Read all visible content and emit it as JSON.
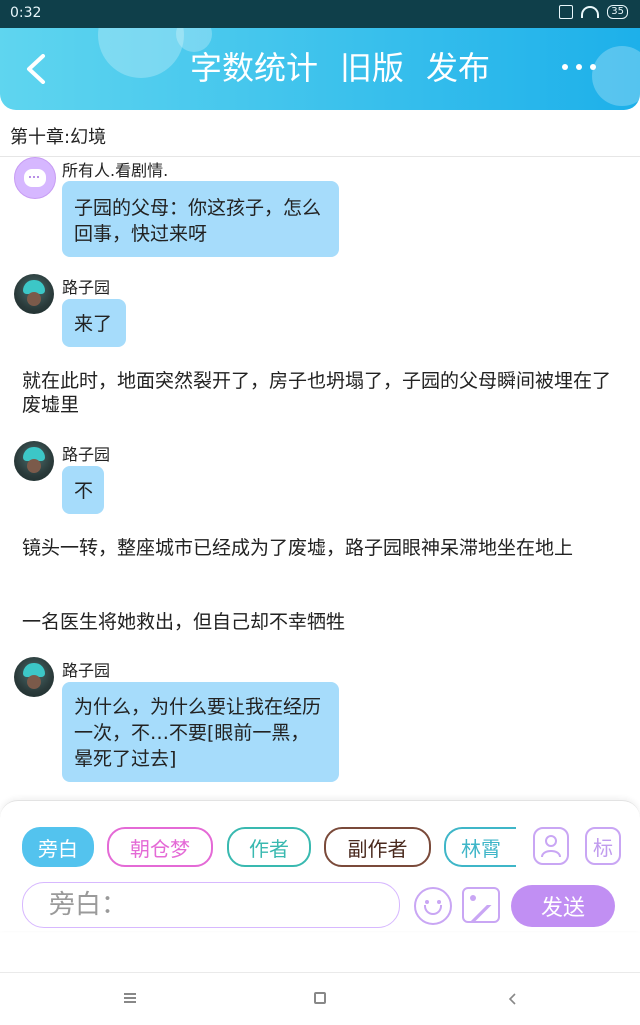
{
  "status_bar": {
    "time": "0:32",
    "battery": "35"
  },
  "header": {
    "actions": [
      "字数统计",
      "旧版",
      "发布"
    ],
    "gradient": [
      "#5fd5ef",
      "#1db0ea"
    ]
  },
  "chapter": {
    "title": "第十章:幻境"
  },
  "messages": {
    "m1": {
      "name": "所有人.看剧情.",
      "text": "子园的父母：你这孩子，怎么回事，快过来呀"
    },
    "m2": {
      "name": "路子园",
      "text": "来了"
    },
    "n1": "就在此时，地面突然裂开了，房子也坍塌了，子园的父母瞬间被埋在了废墟里",
    "m3": {
      "name": "路子园",
      "text": "不"
    },
    "n2": "镜头一转，整座城市已经成为了废墟，路子园眼神呆滞地坐在地上",
    "n3": "一名医生将她救出，但自己却不幸牺牲",
    "m4": {
      "name": "路子园",
      "text": "为什么，为什么要让我在经历一次，不…不要[眼前一黑，晕死了过去]"
    }
  },
  "roles": [
    {
      "label": "旁白",
      "color": "#53c3ee"
    },
    {
      "label": "朝仓梦",
      "color": "#e46ad6"
    },
    {
      "label": "作者",
      "color": "#39b9b0"
    },
    {
      "label": "副作者",
      "color": "#7a4a3a"
    },
    {
      "label": "林霄",
      "color": "#3fb6c8"
    }
  ],
  "role_icon_label": "标",
  "input": {
    "placeholder": "旁白："
  },
  "send_label": "发送",
  "icons": [
    "back-icon",
    "more-icon",
    "person-icon",
    "emoji-icon",
    "image-icon"
  ]
}
